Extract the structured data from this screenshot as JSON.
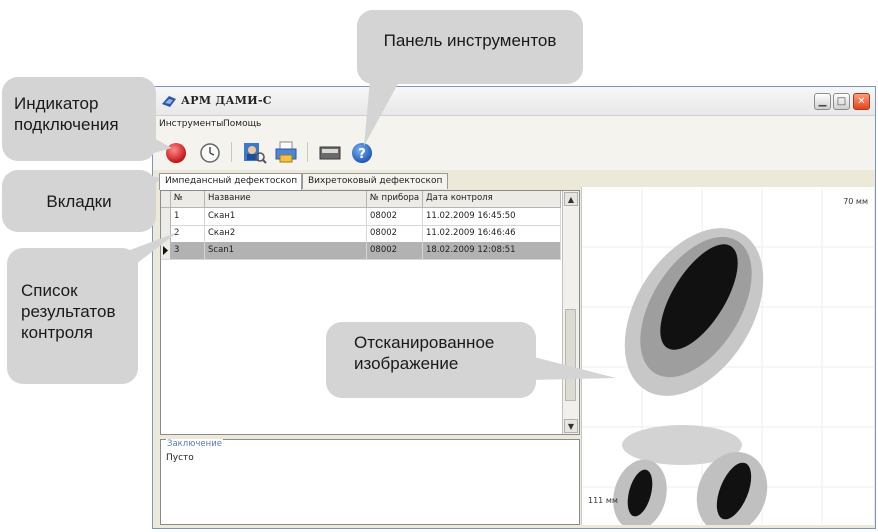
{
  "callouts": {
    "toolbar": "Панель инструментов",
    "connection_indicator": "Индикатор подключения",
    "tabs": "Вкладки",
    "results_list": "Список результатов контроля",
    "scanned_image": "Отсканированное изображение"
  },
  "window": {
    "title": "АРМ ДАМИ-С",
    "menu": [
      "Инструменты",
      "Помощь"
    ]
  },
  "toolbar": {
    "buttons": [
      "connection-indicator-icon",
      "clock-icon",
      "user-search-icon",
      "printer-icon",
      "scanner-icon",
      "help-icon"
    ],
    "connection_color": "#d81b1b"
  },
  "tabs": [
    "Импедансный дефектоскоп",
    "Вихретоковый дефектоскоп"
  ],
  "table": {
    "columns": [
      "№",
      "Название",
      "№ прибора",
      "Дата контроля"
    ],
    "rows": [
      {
        "no": "1",
        "name": "Скан1",
        "device": "08002",
        "date": "11.02.2009 16:45:50"
      },
      {
        "no": "2",
        "name": "Скан2",
        "device": "08002",
        "date": "11.02.2009 16:46:46"
      },
      {
        "no": "3",
        "name": "Scan1",
        "device": "08002",
        "date": "18.02.2009 12:08:51"
      }
    ],
    "selected_row": 3
  },
  "conclusion": {
    "legend": "Заключение",
    "value": "Пусто"
  },
  "image_panel": {
    "scale_top": "70 мм",
    "scale_bottom": "111 мм"
  }
}
